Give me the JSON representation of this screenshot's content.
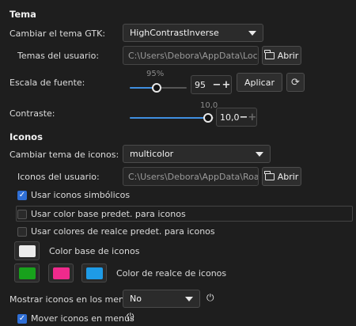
{
  "sections": {
    "theme_header": "Tema",
    "icons_header": "Iconos"
  },
  "gtk": {
    "label": "Cambiar el tema GTK:",
    "value": "HighContrastInverse"
  },
  "user_themes": {
    "label": "Temas del usuario:",
    "path": "C:\\Users\\Debora\\AppData\\Local\\t",
    "open_label": "Abrir"
  },
  "font_scale": {
    "label": "Escala de fuente:",
    "percent_label": "95%",
    "value": "95",
    "slider_fraction": 0.47,
    "apply_label": "Aplicar",
    "minus": "−",
    "plus": "+"
  },
  "contrast": {
    "label": "Contraste:",
    "top_label": "10,0",
    "value": "10,0",
    "slider_fraction": 1.0,
    "minus": "−",
    "plus": "+"
  },
  "icon_theme": {
    "label": "Cambiar tema de iconos:",
    "value": "multicolor"
  },
  "user_icons": {
    "label": "Iconos del usuario:",
    "path": "C:\\Users\\Debora\\AppData\\Roamin",
    "open_label": "Abrir"
  },
  "checks": {
    "symbolic": {
      "label": "Usar iconos simbólicos",
      "checked": true
    },
    "base_color": {
      "label": "Usar color base predet. para iconos",
      "checked": false
    },
    "highlight_colors": {
      "label": "Usar colores de realce predet. para iconos",
      "checked": false
    }
  },
  "colors": {
    "base_label": "Color base de iconos",
    "highlight_label": "Color de realce de iconos",
    "base": "#ececec",
    "highlight_1": "#18a11c",
    "highlight_2": "#ef2a8c",
    "highlight_3": "#1e9be6"
  },
  "menus": {
    "label": "Mostrar iconos en los menús:",
    "value": "No",
    "move_label": "Mover iconos en menús",
    "move_checked": true
  }
}
